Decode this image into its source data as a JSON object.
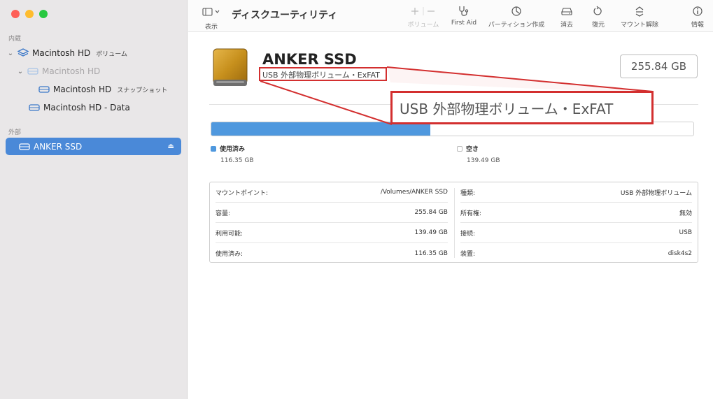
{
  "sidebar": {
    "section_internal": "内蔵",
    "section_external": "外部",
    "items": [
      {
        "label": "Macintosh HD",
        "sub": "ボリューム"
      },
      {
        "label": "Macintosh HD"
      },
      {
        "label": "Macintosh HD",
        "sub": "スナップショット"
      },
      {
        "label": "Macintosh HD - Data"
      },
      {
        "label": "ANKER SSD"
      }
    ]
  },
  "toolbar": {
    "view_label": "表示",
    "title": "ディスクユーティリティ",
    "volume_label": "ボリューム",
    "firstaid_label": "First Aid",
    "partition_label": "パーティション作成",
    "erase_label": "消去",
    "restore_label": "復元",
    "unmount_label": "マウント解除",
    "info_label": "情報"
  },
  "disk": {
    "name": "ANKER SSD",
    "subtitle": "USB 外部物理ボリューム・ExFAT",
    "capacity": "255.84 GB"
  },
  "usage": {
    "used_fraction": 0.4548,
    "used_label": "使用済み",
    "used_value": "116.35 GB",
    "free_label": "空き",
    "free_value": "139.49 GB"
  },
  "info": {
    "left": [
      {
        "key": "マウントポイント:",
        "value": "/Volumes/ANKER SSD"
      },
      {
        "key": "容量:",
        "value": "255.84 GB"
      },
      {
        "key": "利用可能:",
        "value": "139.49 GB"
      },
      {
        "key": "使用済み:",
        "value": "116.35 GB"
      }
    ],
    "right": [
      {
        "key": "種類:",
        "value": "USB 外部物理ボリューム"
      },
      {
        "key": "所有権:",
        "value": "無効"
      },
      {
        "key": "接続:",
        "value": "USB"
      },
      {
        "key": "装置:",
        "value": "disk4s2"
      }
    ]
  },
  "annotation": {
    "zoom_text": "USB 外部物理ボリューム・ExFAT",
    "color": "#d32f2f"
  },
  "colors": {
    "accent": "#4a89d8",
    "used": "#4f98de"
  }
}
